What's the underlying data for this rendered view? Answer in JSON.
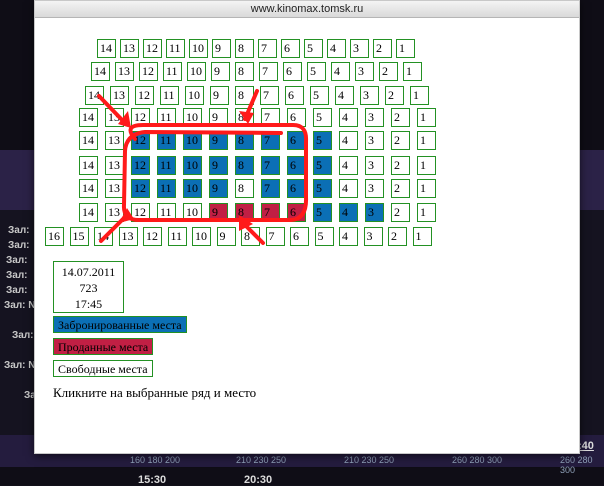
{
  "window": {
    "url": "www.kinomax.tomsk.ru"
  },
  "show": {
    "date": "14.07.2011",
    "number": "723",
    "time": "17:45"
  },
  "legend": {
    "booked": "Забронированные места",
    "sold": "Проданные места",
    "free": "Свободные места"
  },
  "instruction": "Кликните на выбранные ряд и место",
  "colors": {
    "booked": "#0b6fb5",
    "sold": "#c11f44",
    "free": "#ffffff",
    "border": "#239123",
    "annotation": "#ff1a1a"
  },
  "rows": [
    {
      "seats": [
        "14",
        "13",
        "12",
        "11",
        "10",
        "9",
        "8",
        "7",
        "6",
        "5",
        "4",
        "3",
        "2",
        "1"
      ],
      "booked": [],
      "sold": []
    },
    {
      "seats": [
        "14",
        "13",
        "12",
        "11",
        "10",
        "9",
        "8",
        "7",
        "6",
        "5",
        "4",
        "3",
        "2",
        "1"
      ],
      "booked": [],
      "sold": []
    },
    {
      "seats": [
        "14",
        "13",
        "12",
        "11",
        "10",
        "9",
        "8",
        "7",
        "6",
        "5",
        "4",
        "3",
        "2",
        "1"
      ],
      "booked": [],
      "sold": []
    },
    {
      "seats": [
        "14",
        "13",
        "12",
        "11",
        "10",
        "9",
        "8",
        "7",
        "6",
        "5",
        "4",
        "3",
        "2",
        "1"
      ],
      "booked": [],
      "sold": []
    },
    {
      "seats": [
        "14",
        "13",
        "12",
        "11",
        "10",
        "9",
        "8",
        "7",
        "6",
        "5",
        "4",
        "3",
        "2",
        "1"
      ],
      "booked": [
        "12",
        "11",
        "10",
        "9",
        "8",
        "7",
        "6",
        "5"
      ],
      "sold": []
    },
    {
      "seats": [
        "14",
        "13",
        "12",
        "11",
        "10",
        "9",
        "8",
        "7",
        "6",
        "5",
        "4",
        "3",
        "2",
        "1"
      ],
      "booked": [
        "12",
        "11",
        "10",
        "9",
        "8",
        "7",
        "6",
        "5"
      ],
      "sold": []
    },
    {
      "seats": [
        "14",
        "13",
        "12",
        "11",
        "10",
        "9",
        "8",
        "7",
        "6",
        "5",
        "4",
        "3",
        "2",
        "1"
      ],
      "booked": [
        "12",
        "11",
        "10",
        "9",
        "7",
        "6",
        "5"
      ],
      "sold": []
    },
    {
      "seats": [
        "14",
        "13",
        "12",
        "11",
        "10",
        "9",
        "8",
        "7",
        "6",
        "5",
        "4",
        "3",
        "2",
        "1"
      ],
      "booked": [
        "5",
        "4",
        "3"
      ],
      "sold": [
        "9",
        "8",
        "7",
        "6"
      ]
    },
    {
      "seats": [
        "16",
        "15",
        "14",
        "13",
        "12",
        "11",
        "10",
        "9",
        "8",
        "7",
        "6",
        "5",
        "4",
        "3",
        "2",
        "1"
      ],
      "booked": [],
      "sold": []
    }
  ],
  "background": {
    "labels": [
      "Зал:",
      "Зал:",
      "Зал:",
      "Зал:",
      "Зал:",
      "Зал:",
      "Зал: N",
      "Зал:",
      "Зал: N",
      "Зал:"
    ],
    "prices": [
      "160 180 200",
      "210 230 250",
      "210 230 250",
      "260 280 300",
      "260 280 300"
    ],
    "times": [
      "15:30",
      "20:30"
    ],
    "corner_time": ":40"
  }
}
